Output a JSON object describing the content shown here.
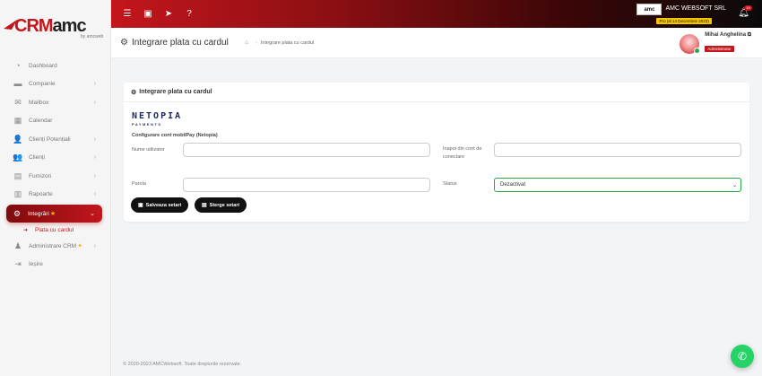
{
  "brand": {
    "logo_part1": "CRM",
    "logo_part2": "amc",
    "logo_sub": "by amcweb"
  },
  "topbar": {
    "company_name": "AMC WEBSOFT SRL",
    "company_logo_text": "amc",
    "plan_badge": "Pro (al 14 Decembrie 2023)",
    "notifications_count": "19"
  },
  "sidebar": {
    "items": [
      {
        "label": "Dashboard",
        "icon": "gauge-icon",
        "chevron": false
      },
      {
        "label": "Companie",
        "icon": "briefcase-icon",
        "chevron": true
      },
      {
        "label": "Mailbox",
        "icon": "envelope-icon",
        "chevron": true
      },
      {
        "label": "Calendar",
        "icon": "calendar-icon",
        "chevron": false
      },
      {
        "label": "Clienți Potențiali",
        "icon": "user-plus-icon",
        "chevron": true
      },
      {
        "label": "Clienți",
        "icon": "users-icon",
        "chevron": true
      },
      {
        "label": "Furnizori",
        "icon": "building-icon",
        "chevron": true
      },
      {
        "label": "Rapoarte",
        "icon": "bar-chart-icon",
        "chevron": true
      },
      {
        "label": "Integrări",
        "icon": "gears-icon",
        "chevron": true,
        "active": true
      },
      {
        "label": "Plata cu cardul",
        "sub": true
      },
      {
        "label": "Administrare CRM",
        "icon": "user-shield-icon",
        "chevron": true
      },
      {
        "label": "Ieșire",
        "icon": "sign-out-icon",
        "chevron": false
      }
    ]
  },
  "page": {
    "title": "Integrare plata cu cardul",
    "breadcrumb_current": "Integrare plata cu cardul"
  },
  "user": {
    "name": "Mihai Anghelina",
    "role": "Administrator"
  },
  "card": {
    "title": "Integrare plata cu cardul",
    "provider_logo_main": "NETOPIA",
    "provider_logo_sub": "PAYMENTS",
    "config_title": "Configurare cont mobilPay (Netopia)",
    "fields": {
      "username_label": "Nume utilizator",
      "username_value": "",
      "merchant_label": "Inapoi din cont de conectare",
      "merchant_value": "",
      "password_label": "Parola",
      "password_value": "",
      "status_label": "Status",
      "status_value": "Dezactivat"
    },
    "save_button": "Salveaza setari",
    "delete_button": "Sterge setari"
  },
  "footer": {
    "text": "© 2020-2023 AMCWebsoft. Toate drepturile rezervate."
  }
}
